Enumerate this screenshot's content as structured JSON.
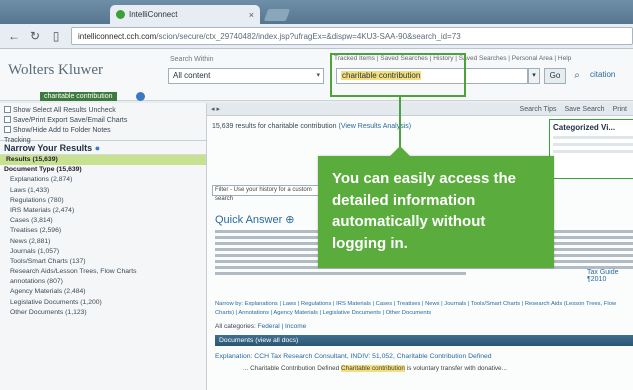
{
  "browser": {
    "tab_title": "IntelliConnect",
    "url_domain": "intelliconnect.cch.com",
    "url_rest": "/scion/secure/ctx_29740482/index.jsp?ufragEx=&dispw=4KU3-SAA-90&search_id=73"
  },
  "header": {
    "logo": "Wolters Kluwer",
    "search_within_label": "Search Within",
    "scope_value": "All content",
    "query_value": "charitable contribution",
    "go_label": "Go",
    "cite_label": "citation",
    "top_links": "Tracked Items | Saved Searches | History | Saved Searches | Personal Area | Help"
  },
  "breadcrumb": {
    "tag": "charitable contribution"
  },
  "left": {
    "toolbar_lines": [
      "Show   Select All Results   Uncheck",
      "Save/Print   Export   Save/Email Charts",
      "Show/Hide   Add to Folder   Notes",
      "Tracking"
    ],
    "narrow_title": "Narrow Your Results",
    "items": [
      {
        "label": "Results (15,639)",
        "kind": "head"
      },
      {
        "label": "Document Type (15,639)",
        "kind": "sub"
      },
      {
        "label": "Explanations (2,874)",
        "kind": "sub2"
      },
      {
        "label": "Laws (1,433)",
        "kind": "sub2"
      },
      {
        "label": "Regulations (780)",
        "kind": "sub2"
      },
      {
        "label": "IRS Materials (2,474)",
        "kind": "sub2"
      },
      {
        "label": "Cases (3,814)",
        "kind": "sub2"
      },
      {
        "label": "Treatises (2,596)",
        "kind": "sub2"
      },
      {
        "label": "News (2,881)",
        "kind": "sub2"
      },
      {
        "label": "Journals (1,057)",
        "kind": "sub2"
      },
      {
        "label": "Tools/Smart Charts (137)",
        "kind": "sub2"
      },
      {
        "label": "Research Aids/Lesson Trees, Flow Charts",
        "kind": "sub2"
      },
      {
        "label": "annotations (807)",
        "kind": "sub2"
      },
      {
        "label": "Agency Materials (2,484)",
        "kind": "sub2"
      },
      {
        "label": "Legislative Documents (1,200)",
        "kind": "sub2"
      },
      {
        "label": "Other Documents (1,123)",
        "kind": "sub2"
      }
    ]
  },
  "main": {
    "bar_left": "◂ ▸",
    "bar_items": [
      "Search Tips",
      "Save Search",
      "Print"
    ],
    "results_count": "15,639 results for charitable contribution",
    "results_link": "(View Results Analysis)",
    "categorized_title": "Categorized Vi...",
    "filter_text": "Filter - Use your history for a custom search",
    "qa_title": "Quick Answer",
    "qa_link": "Tax Guide ¶2010",
    "facets": "Narrow by:  Explanations | Laws | Regulations | IRS Materials | Cases | Treatises | News | Journals | Tools/Smart Charts | Research Aids (Lesson Trees, Flow Charts) | Annotations | Agency Materials | Legislative Documents | Other Documents",
    "categories_label": "All categories:",
    "categories_links": "Federal | Income",
    "docs_bar": "Documents  (view all docs)",
    "result_title": "Explanation: CCH Tax Research Consultant, INDIV: 51,052, Charitable Contribution Defined",
    "result_sub_pre": "... Charitable Contribution Defined ",
    "result_sub_hl": "Charitable contribution",
    "result_sub_post": " is voluntary transfer with donative..."
  },
  "callout": {
    "text": "You can easily access the detailed information automatically without logging in."
  }
}
